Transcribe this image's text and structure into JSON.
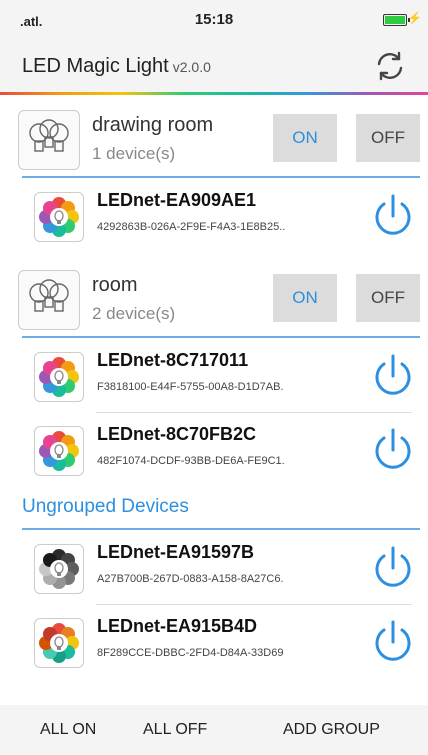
{
  "status": {
    "signal": ".atl.",
    "time": "15:18",
    "bolt": "⚡"
  },
  "header": {
    "title": "LED Magic Light",
    "version": "v2.0.0"
  },
  "groups": [
    {
      "name": "drawing room",
      "count": "1 device(s)",
      "on_label": "ON",
      "off_label": "OFF",
      "devices": [
        {
          "name": "LEDnet-EA909AE1",
          "id": "4292863B-026A-2F9E-F4A3-1E8B25..",
          "palette": "color"
        }
      ]
    },
    {
      "name": "room",
      "count": "2 device(s)",
      "on_label": "ON",
      "off_label": "OFF",
      "devices": [
        {
          "name": "LEDnet-8C717011",
          "id": "F3818100-E44F-5755-00A8-D1D7AB.",
          "palette": "color"
        },
        {
          "name": "LEDnet-8C70FB2C",
          "id": "482F1074-DCDF-93BB-DE6A-FE9C1.",
          "palette": "color"
        }
      ]
    }
  ],
  "ungrouped": {
    "title": "Ungrouped Devices",
    "devices": [
      {
        "name": "LEDnet-EA91597B",
        "id": "A27B700B-267D-0883-A158-8A27C6.",
        "palette": "grey"
      },
      {
        "name": "LEDnet-EA915B4D",
        "id": "8F289CCE-DBBC-2FD4-D84A-33D69",
        "palette": "warm"
      }
    ]
  },
  "footer": {
    "all_on": "ALL ON",
    "all_off": "ALL OFF",
    "add_group": "ADD GROUP"
  },
  "colors": {
    "accent": "#2d8fe0",
    "button_bg": "#dcdcdc",
    "separator": "#6aaee5"
  },
  "icons": {
    "refresh": "refresh-icon",
    "power": "power-icon",
    "bulbs": "bulbs-icon",
    "color-wheel": "color-wheel-icon"
  }
}
